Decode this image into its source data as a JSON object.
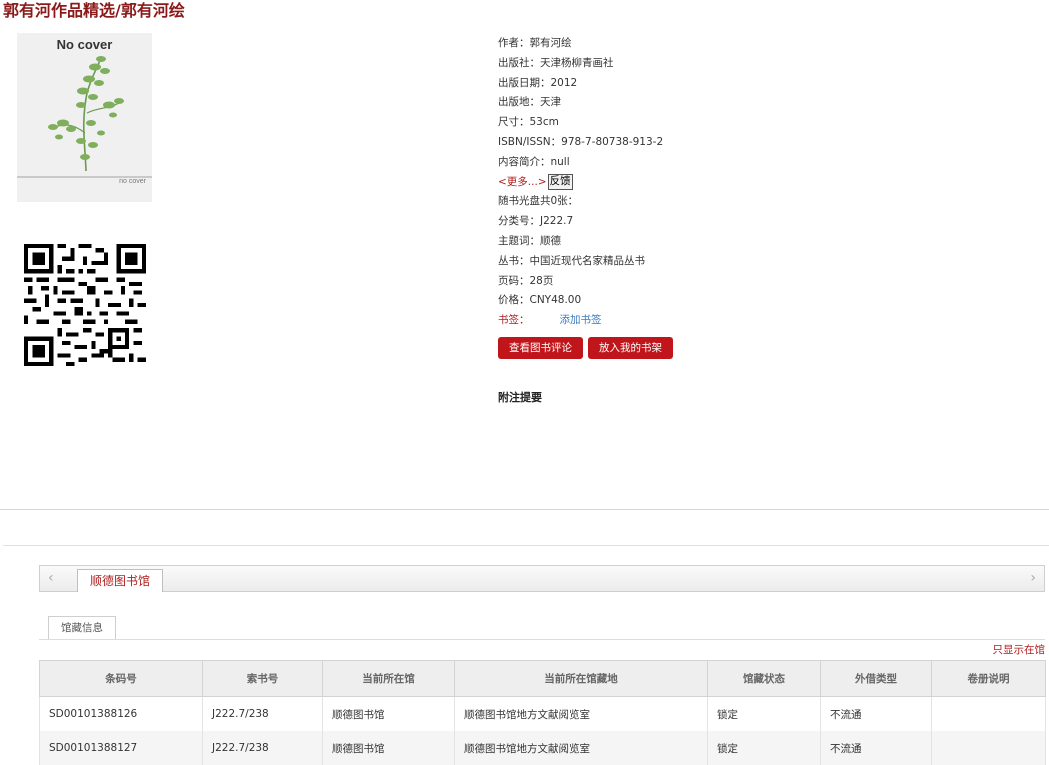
{
  "page": {
    "title": "郭有河作品精选/郭有河绘"
  },
  "cover": {
    "top_text": "No cover",
    "bottom_text": "no cover"
  },
  "details": [
    "作者：郭有河绘",
    "出版社：天津杨柳青画社",
    "出版日期：2012",
    "出版地：天津",
    "尺寸：53cm",
    "ISBN/ISSN：978-7-80738-913-2",
    "内容简介：null"
  ],
  "more": {
    "link": "<更多...>",
    "feedback": "反馈"
  },
  "details2": [
    "随书光盘共0张：",
    "分类号：J222.7",
    "主题词：顺德",
    "丛书：中国近现代名家精品丛书",
    "页码：28页",
    "价格：CNY48.00"
  ],
  "bookmark": {
    "label": "书签：",
    "add": "添加书签"
  },
  "buttons": {
    "reviews": "查看图书评论",
    "shelf": "放入我的书架"
  },
  "annotation": "附注提要",
  "library_tab": "顺德图书馆",
  "holdings_tab": "馆藏信息",
  "only_show": "只显示在馆",
  "table": {
    "headers": [
      "条码号",
      "索书号",
      "当前所在馆",
      "当前所在馆藏地",
      "馆藏状态",
      "外借类型",
      "卷册说明"
    ],
    "rows": [
      [
        "SD00101388126",
        "J222.7/238",
        "顺德图书馆",
        "顺德图书馆地方文献阅览室",
        "锁定",
        "不流通",
        ""
      ],
      [
        "SD00101388127",
        "J222.7/238",
        "顺德图书馆",
        "顺德图书馆地方文献阅览室",
        "锁定",
        "不流通",
        ""
      ]
    ]
  },
  "colors": {
    "accent": "#b01e1e",
    "button": "#c0161b",
    "link": "#3b7cc0"
  }
}
